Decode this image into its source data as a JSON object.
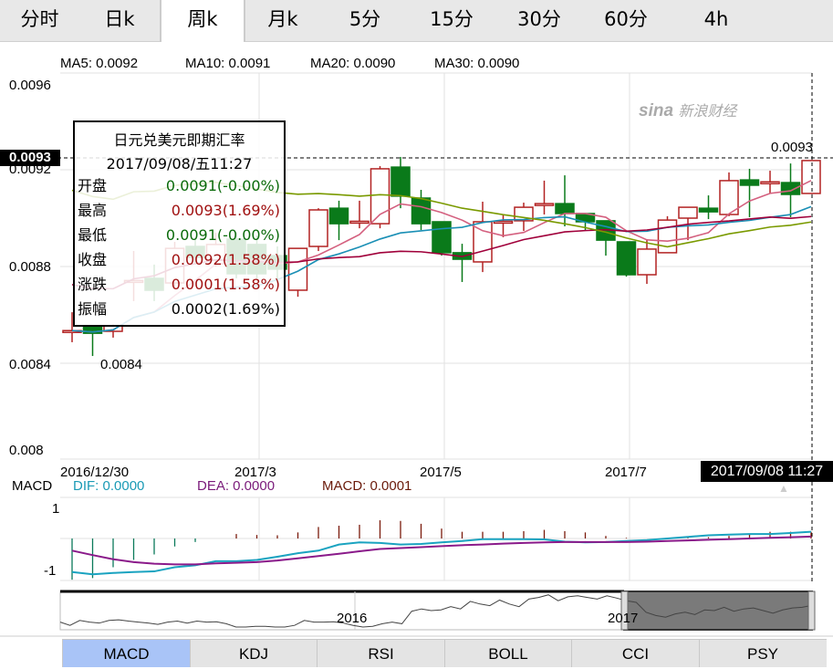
{
  "period_tabs": [
    {
      "label": "分时",
      "active": false
    },
    {
      "label": "日k",
      "active": false
    },
    {
      "label": "周k",
      "active": true
    },
    {
      "label": "月k",
      "active": false
    },
    {
      "label": "5分",
      "active": false
    },
    {
      "label": "15分",
      "active": false
    },
    {
      "label": "30分",
      "active": false
    },
    {
      "label": "60分",
      "active": false
    },
    {
      "label": "4h",
      "active": false
    }
  ],
  "ma_legend": {
    "ma5": "MA5: 0.0092",
    "ma10": "MA10: 0.0091",
    "ma20": "MA20: 0.0090",
    "ma30": "MA30: 0.0090"
  },
  "colors": {
    "ma5": "#d4607f",
    "ma10": "#1a8fb5",
    "ma20": "#a0003a",
    "ma30": "#7a9a00",
    "up": "#b22222",
    "down": "#0a7a1a",
    "dif": "#1aa3c0",
    "dea": "#8a1a8a",
    "macd": "#7a1a0a"
  },
  "y_axis": {
    "labels": [
      "0.0096",
      "0.0092",
      "0.0088",
      "0.0084",
      "0.008"
    ],
    "crosshair_value": "0.0093",
    "max_label": "0.0093",
    "min_label": "0.0084"
  },
  "x_axis": {
    "labels": [
      "2016/12/30",
      "2017/3",
      "2017/5",
      "2017/7"
    ],
    "crosshair_date": "2017/09/08 11:27"
  },
  "watermark": {
    "brand": "sina",
    "text": "新浪财经"
  },
  "tooltip": {
    "title": "日元兑美元即期汇率",
    "datetime": "2017/09/08/五11:27",
    "rows": [
      {
        "label": "开盘",
        "value": "0.0091(-0.00%)",
        "color": "#0a6a0a"
      },
      {
        "label": "最高",
        "value": "0.0093(1.69%)",
        "color": "#a01010"
      },
      {
        "label": "最低",
        "value": "0.0091(-0.00%)",
        "color": "#0a6a0a"
      },
      {
        "label": "收盘",
        "value": "0.0092(1.58%)",
        "color": "#a01010"
      },
      {
        "label": "涨跌",
        "value": "0.0001(1.58%)",
        "color": "#a01010"
      },
      {
        "label": "振幅",
        "value": "0.0002(1.69%)",
        "color": "#000000"
      }
    ]
  },
  "macd_legend": {
    "title": "MACD",
    "dif": "DIF: 0.0000",
    "dea": "DEA: 0.0000",
    "macd": "MACD: 0.0001",
    "y_labels": [
      "1",
      "-1"
    ]
  },
  "navigator": {
    "labels": [
      "2016",
      "2017"
    ],
    "selection_start": 0.75,
    "selection_end": 1.0,
    "series": [
      0.15,
      0.05,
      0.2,
      0.15,
      0.12,
      0.2,
      0.22,
      0.18,
      0.15,
      0.12,
      0.08,
      0.15,
      0.18,
      0.12,
      0.18,
      0.15,
      0.16,
      0.1,
      0.0,
      0.0,
      0.02,
      0.02,
      0.0,
      0.0,
      0.05,
      0.2,
      0.15,
      0.15,
      0.16,
      0.12,
      0.05,
      0.0,
      0.02,
      0.1,
      0.15,
      0.1,
      0.48,
      0.55,
      0.5,
      0.52,
      0.62,
      0.55,
      0.78,
      0.7,
      0.65,
      0.82,
      0.7,
      0.62,
      0.85,
      0.9,
      0.98,
      0.8,
      0.92,
      0.95,
      0.9,
      0.85,
      0.95,
      0.88,
      0.8,
      0.75,
      0.45,
      0.35,
      0.3,
      0.4,
      0.45,
      0.38,
      0.52,
      0.5,
      0.6,
      0.48,
      0.55,
      0.58,
      0.5,
      0.42,
      0.52,
      0.58,
      0.6,
      0.66
    ]
  },
  "indicator_tabs": [
    {
      "label": "MACD",
      "active": true
    },
    {
      "label": "KDJ"
    },
    {
      "label": "RSI"
    },
    {
      "label": "BOLL"
    },
    {
      "label": "CCI"
    },
    {
      "label": "PSY"
    }
  ],
  "chart_data": {
    "type": "candlestick",
    "title": "日元兑美元即期汇率 周k",
    "ylim": [
      0.008,
      0.0096
    ],
    "ohlc": [
      [
        0.008532,
        0.008611,
        0.008487,
        0.008535
      ],
      [
        0.008555,
        0.008558,
        0.00843,
        0.008524
      ],
      [
        0.008532,
        0.00856,
        0.008506,
        0.008555
      ],
      [
        0.00874,
        0.008864,
        0.008657,
        0.008742
      ],
      [
        0.008751,
        0.008808,
        0.008657,
        0.008702
      ],
      [
        0.008732,
        0.008902,
        0.008713,
        0.008875
      ],
      [
        0.008883,
        0.008913,
        0.008808,
        0.008838
      ],
      [
        0.008826,
        0.00894,
        0.0088,
        0.008891
      ],
      [
        0.008913,
        0.00894,
        0.008751,
        0.00877
      ],
      [
        0.008891,
        0.008928,
        0.008751,
        0.00877
      ],
      [
        0.008845,
        0.008883,
        0.008732,
        0.008789
      ],
      [
        0.008702,
        0.008875,
        0.008675,
        0.008875
      ],
      [
        0.008883,
        0.009041,
        0.008864,
        0.009034
      ],
      [
        0.009041,
        0.009072,
        0.008909,
        0.008977
      ],
      [
        0.008985,
        0.009072,
        0.008958,
        0.008987
      ],
      [
        0.008977,
        0.009215,
        0.008958,
        0.009204
      ],
      [
        0.009211,
        0.009253,
        0.009041,
        0.009091
      ],
      [
        0.009083,
        0.009117,
        0.008951,
        0.008977
      ],
      [
        0.008985,
        0.008985,
        0.008845,
        0.008857
      ],
      [
        0.008857,
        0.008894,
        0.008736,
        0.00883
      ],
      [
        0.008819,
        0.009068,
        0.008777,
        0.008985
      ],
      [
        0.008985,
        0.009015,
        0.008921,
        0.008987
      ],
      [
        0.008989,
        0.009064,
        0.008947,
        0.009045
      ],
      [
        0.009057,
        0.009155,
        0.009015,
        0.00906
      ],
      [
        0.00906,
        0.009177,
        0.008966,
        0.009019
      ],
      [
        0.009019,
        0.009019,
        0.008947,
        0.008985
      ],
      [
        0.008989,
        0.008989,
        0.008845,
        0.008909
      ],
      [
        0.008902,
        0.008902,
        0.008758,
        0.008766
      ],
      [
        0.008766,
        0.008909,
        0.008728,
        0.008872
      ],
      [
        0.008857,
        0.009008,
        0.008857,
        0.008992
      ],
      [
        0.009,
        0.009045,
        0.008909,
        0.009045
      ],
      [
        0.009041,
        0.009094,
        0.008996,
        0.009026
      ],
      [
        0.009015,
        0.009189,
        0.009008,
        0.009155
      ],
      [
        0.009158,
        0.009204,
        0.009004,
        0.009136
      ],
      [
        0.009147,
        0.009196,
        0.009102,
        0.00915
      ],
      [
        0.009147,
        0.009226,
        0.009004,
        0.009098
      ],
      [
        0.009102,
        0.009238,
        0.009102,
        0.009238
      ]
    ],
    "macd": {
      "ylim": [
        -1,
        1
      ],
      "hist": [
        -1.29,
        -1.24,
        -0.9,
        -0.67,
        -0.5,
        -0.25,
        -0.11,
        0,
        0.14,
        0.11,
        0.1,
        0.19,
        0.36,
        0.4,
        0.43,
        0.57,
        0.55,
        0.46,
        0.31,
        0.21,
        0.21,
        0.21,
        0.23,
        0.27,
        0.23,
        0.19,
        0.08,
        0.02,
        0,
        0,
        0.02,
        0.04,
        0.08,
        0.15,
        0.21,
        0.21,
        0.21
      ],
      "dif": [
        -1.05,
        -1.12,
        -1.08,
        -1.05,
        -1.03,
        -0.9,
        -0.84,
        -0.71,
        -0.71,
        -0.67,
        -0.57,
        -0.46,
        -0.38,
        -0.19,
        -0.12,
        -0.14,
        -0.19,
        -0.17,
        -0.12,
        -0.08,
        -0.02,
        -0.02,
        -0.02,
        -0.03,
        -0.1,
        -0.12,
        -0.11,
        -0.08,
        -0.05,
        0,
        0.05,
        0.1,
        0.12,
        0.14,
        0.14,
        0.17,
        0.21
      ],
      "dea": [
        -0.38,
        -0.52,
        -0.65,
        -0.74,
        -0.79,
        -0.81,
        -0.81,
        -0.78,
        -0.76,
        -0.74,
        -0.69,
        -0.62,
        -0.55,
        -0.48,
        -0.4,
        -0.33,
        -0.3,
        -0.27,
        -0.24,
        -0.21,
        -0.19,
        -0.16,
        -0.14,
        -0.12,
        -0.11,
        -0.11,
        -0.11,
        -0.11,
        -0.1,
        -0.08,
        -0.06,
        -0.04,
        -0.02,
        0,
        0.02,
        0.04,
        0.06
      ]
    }
  }
}
